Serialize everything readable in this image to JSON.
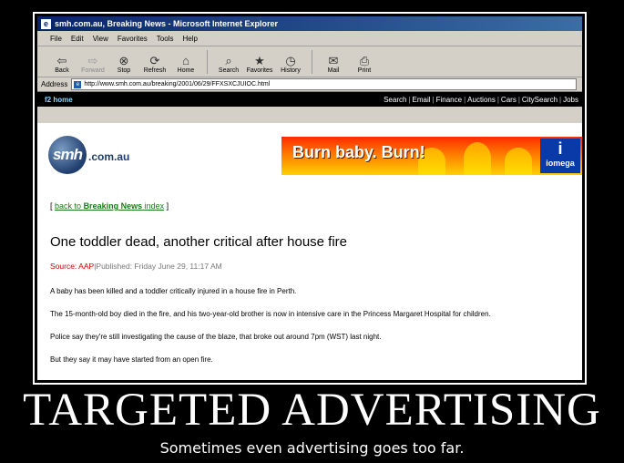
{
  "window": {
    "title": "smh.com.au, Breaking News - Microsoft Internet Explorer"
  },
  "menu": [
    "File",
    "Edit",
    "View",
    "Favorites",
    "Tools",
    "Help"
  ],
  "toolbar": {
    "back": "Back",
    "forward": "Forward",
    "stop": "Stop",
    "refresh": "Refresh",
    "home": "Home",
    "search": "Search",
    "favorites": "Favorites",
    "history": "History",
    "mail": "Mail",
    "print": "Print"
  },
  "address": {
    "label": "Address",
    "url": "http://www.smh.com.au/breaking/2001/06/29/FFXSXCJUIOC.html"
  },
  "site_nav": {
    "home": "f2 home",
    "links": [
      "Search",
      "Email",
      "Finance",
      "Auctions",
      "Cars",
      "CitySearch",
      "Jobs"
    ]
  },
  "logo": {
    "mark": "smh",
    "domain": ".com.au"
  },
  "banner": {
    "text": "Burn baby. Burn!",
    "brand": "iomega",
    "brand_mark": "i"
  },
  "article": {
    "back_open": "[",
    "back_prefix": "back to ",
    "back_bold": "Breaking News",
    "back_suffix": " index",
    "back_close": "]",
    "headline": "One toddler dead, another critical after house fire",
    "source_label": "Source: AAP",
    "published": "|Published: Friday June 29, 11:17 AM",
    "paragraphs": [
      "A baby has been killed and a toddler critically injured in a house fire in Perth.",
      "The 15-month-old boy died in the fire, and his two-year-old brother is now in intensive care in the Princess Margaret Hospital for children.",
      "Police say they're still investigating the cause of the blaze, that broke out around 7pm (WST) last night.",
      "But they say it may have started from an open fire."
    ]
  },
  "poster": {
    "title": "TARGETED ADVERTISING",
    "subtitle": "Sometimes even advertising goes too far."
  }
}
